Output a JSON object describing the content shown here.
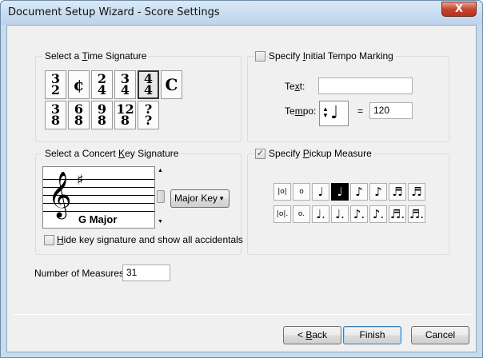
{
  "window": {
    "title": "Document Setup Wizard - Score Settings",
    "close_label": "X"
  },
  "time_signature": {
    "group_label_pre": "Select a ",
    "group_label_u": "T",
    "group_label_post": "ime Signature",
    "row1": [
      {
        "top": "3",
        "bottom": "2"
      },
      {
        "symbol": "¢"
      },
      {
        "top": "2",
        "bottom": "4"
      },
      {
        "top": "3",
        "bottom": "4"
      },
      {
        "top": "4",
        "bottom": "4",
        "selected": true
      },
      {
        "symbol": "C"
      }
    ],
    "row2": [
      {
        "top": "3",
        "bottom": "8"
      },
      {
        "top": "6",
        "bottom": "8"
      },
      {
        "top": "9",
        "bottom": "8"
      },
      {
        "top": "12",
        "bottom": "8"
      },
      {
        "top": "?",
        "bottom": "?"
      }
    ]
  },
  "tempo": {
    "checkbox_label_pre": "Specify ",
    "checkbox_label_u": "I",
    "checkbox_label_post": "nitial Tempo Marking",
    "checked": false,
    "text_label_pre": "Te",
    "text_label_u": "x",
    "text_label_post": "t:",
    "text_value": "",
    "tempo_label_pre": "Te",
    "tempo_label_u": "m",
    "tempo_label_post": "po:",
    "equals": "=",
    "tempo_value": "120",
    "note_glyph": "♩"
  },
  "key_signature": {
    "group_label_pre": "Select a Concert ",
    "group_label_u": "K",
    "group_label_post": "ey Signature",
    "key_name": "G Major",
    "mode_value": "Major Key",
    "hide_label_pre": "",
    "hide_label_u": "H",
    "hide_label_post": "ide key signature and show all accidentals",
    "hide_checked": false
  },
  "pickup": {
    "checkbox_label_pre": "Specify ",
    "checkbox_label_u": "P",
    "checkbox_label_post": "ickup Measure",
    "checked": true,
    "row1": [
      "|o|",
      "o",
      "♩",
      "♩",
      "♪",
      "♪",
      "♬",
      "♬"
    ],
    "row2": [
      "|o|.",
      "o.",
      "♩.",
      "♩.",
      "♪.",
      "♪.",
      "♬.",
      "♬."
    ]
  },
  "measures": {
    "label": "Number of Measures:",
    "value": "31"
  },
  "buttons": {
    "back_pre": "< ",
    "back_u": "B",
    "back_post": "ack",
    "finish": "Finish",
    "cancel": "Cancel"
  }
}
